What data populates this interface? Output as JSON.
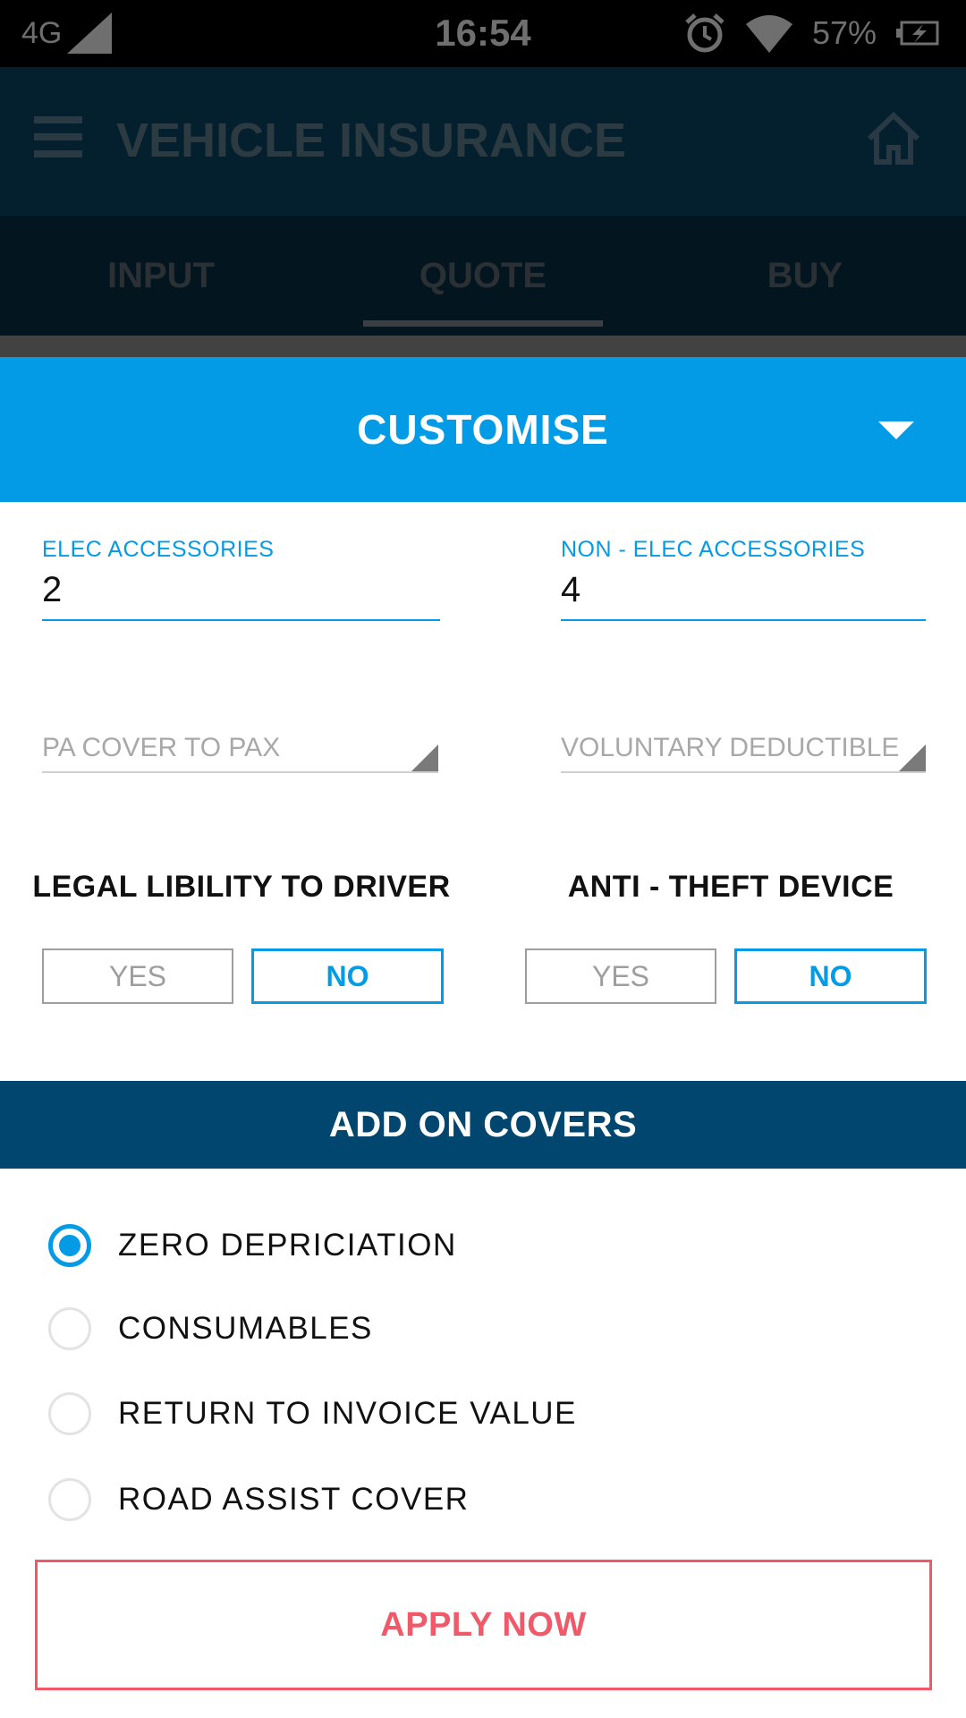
{
  "status_bar": {
    "network": "4G",
    "time": "16:54",
    "battery": "57%"
  },
  "app_bar": {
    "title": "VEHICLE INSURANCE"
  },
  "tabs": [
    {
      "label": "INPUT",
      "active": false
    },
    {
      "label": "QUOTE",
      "active": true
    },
    {
      "label": "BUY",
      "active": false
    }
  ],
  "customise": {
    "title": "CUSTOMISE",
    "elec_accessories": {
      "label": "ELEC ACCESSORIES",
      "value": "2"
    },
    "non_elec_accessories": {
      "label": "NON - ELEC ACCESSORIES",
      "value": "4"
    },
    "pa_cover": {
      "value": "PA COVER TO PAX"
    },
    "voluntary_deductible": {
      "value": "VOLUNTARY DEDUCTIBLE"
    },
    "legal_liability": {
      "label": "LEGAL LIBILITY TO DRIVER",
      "yes": "YES",
      "no": "NO",
      "selected": "NO"
    },
    "anti_theft": {
      "label": "ANTI - THEFT DEVICE",
      "yes": "YES",
      "no": "NO",
      "selected": "NO"
    }
  },
  "add_on_covers": {
    "title": "ADD ON COVERS",
    "options": [
      {
        "label": "ZERO DEPRICIATION",
        "checked": true
      },
      {
        "label": "CONSUMABLES",
        "checked": false
      },
      {
        "label": "RETURN TO INVOICE VALUE",
        "checked": false
      },
      {
        "label": "ROAD ASSIST COVER",
        "checked": false
      }
    ]
  },
  "apply_button": {
    "label": "APPLY NOW"
  },
  "colors": {
    "primary_blue": "#039be5",
    "navy": "#01466f",
    "apply_red": "#ef5a6a"
  }
}
